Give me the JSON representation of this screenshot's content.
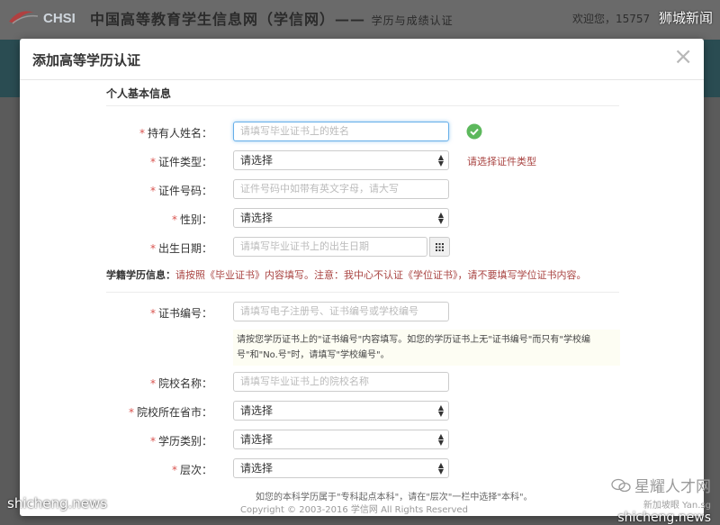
{
  "background": {
    "brand": "CHSI",
    "site_title": "中国高等教育学生信息网（学信网）——",
    "site_subtitle": "学历与成绩认证",
    "user_info": "欢迎您，15757"
  },
  "watermarks": {
    "top_right": "狮城新闻",
    "bottom_left": "shicheng.news",
    "brand_name": "星耀人才网",
    "brand_sub": "新加坡眼 Yan.sg",
    "bottom_right_url": "shicheng.news"
  },
  "modal": {
    "title": "添加高等学历认证",
    "close": "×",
    "personal_section": "个人基本信息",
    "fields": {
      "name": {
        "label": "持有人姓名：",
        "placeholder": "请填写毕业证书上的姓名"
      },
      "id_type": {
        "label": "证件类型：",
        "value": "请选择",
        "error": "请选择证件类型"
      },
      "id_number": {
        "label": "证件号码：",
        "placeholder": "证件号码中如带有英文字母，请大写"
      },
      "gender": {
        "label": "性别：",
        "value": "请选择"
      },
      "birth_date": {
        "label": "出生日期：",
        "placeholder": "请填写毕业证书上的出生日期"
      }
    },
    "education": {
      "title": "学籍学历信息：",
      "note": "请按照《毕业证书》内容填写。注意：我中心不认证《学位证书》，请不要填写学位证书内容。",
      "fields": {
        "cert_no": {
          "label": "证书编号：",
          "placeholder": "请填写电子注册号、证书编号或学校编号"
        },
        "cert_help": "请按您学历证书上的\"证书编号\"内容填写。如您的学历证书上无\"证书编号\"而只有\"学校编号\"和\"No.号\"时，请填写\"学校编号\"。",
        "school": {
          "label": "院校名称：",
          "placeholder": "请填写毕业证书上的院校名称"
        },
        "province": {
          "label": "院校所在省市：",
          "value": "请选择"
        },
        "edu_type": {
          "label": "学历类别：",
          "value": "请选择"
        },
        "level": {
          "label": "层次：",
          "value": "请选择"
        }
      },
      "cutoff_hint": "如您的本科学历属于\"专科起点本科\"，请在\"层次\"一栏中选择\"本科\"。",
      "footer": "Copyright © 2003-2016 学信网 All Rights Reserved"
    }
  },
  "colors": {
    "required": "#d9534f",
    "error": "#a94442",
    "ok": "#5cb85c"
  }
}
